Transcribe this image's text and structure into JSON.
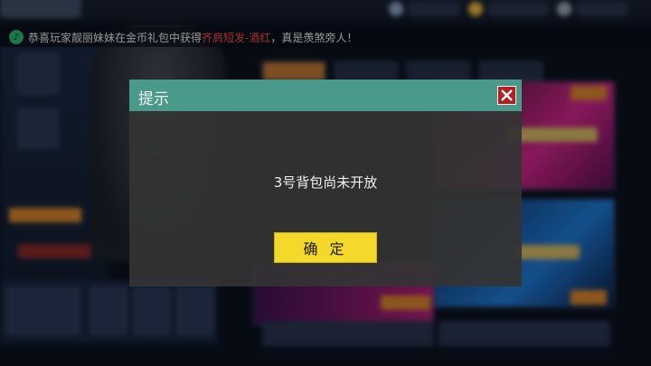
{
  "broadcast": {
    "icon": "speaker-icon",
    "prefix": "恭喜玩家靓丽妹妹在金币礼包中获得",
    "highlight": "齐肩短发-酒红",
    "suffix": "，真是羡煞旁人！"
  },
  "dialog": {
    "title": "提示",
    "message": "3号背包尚未开放",
    "confirm_label": "确 定",
    "close_icon": "close-icon"
  },
  "colors": {
    "dialog_header": "#4a9a8c",
    "confirm_button": "#f4d92a",
    "close_button": "#b41e1e",
    "highlight_text": "#ff4a4a"
  }
}
